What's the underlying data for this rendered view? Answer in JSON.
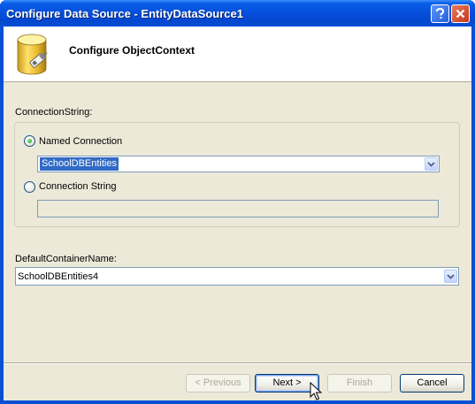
{
  "window": {
    "title": "Configure Data Source - EntityDataSource1"
  },
  "header": {
    "title": "Configure ObjectContext"
  },
  "connection": {
    "label": "ConnectionString:",
    "named_option": {
      "label": "Named Connection",
      "selected": true
    },
    "named_combo_value": "SchoolDBEntities",
    "string_option": {
      "label": "Connection String",
      "selected": false
    },
    "string_value": ""
  },
  "container": {
    "label": "DefaultContainerName:",
    "combo_value": "SchoolDBEntities4"
  },
  "buttons": {
    "previous": "< Previous",
    "next": "Next >",
    "finish": "Finish",
    "cancel": "Cancel"
  },
  "colors": {
    "titlebar": "#0a5fe8",
    "dialog_bg": "#ece9d8",
    "selection": "#316ac5"
  }
}
